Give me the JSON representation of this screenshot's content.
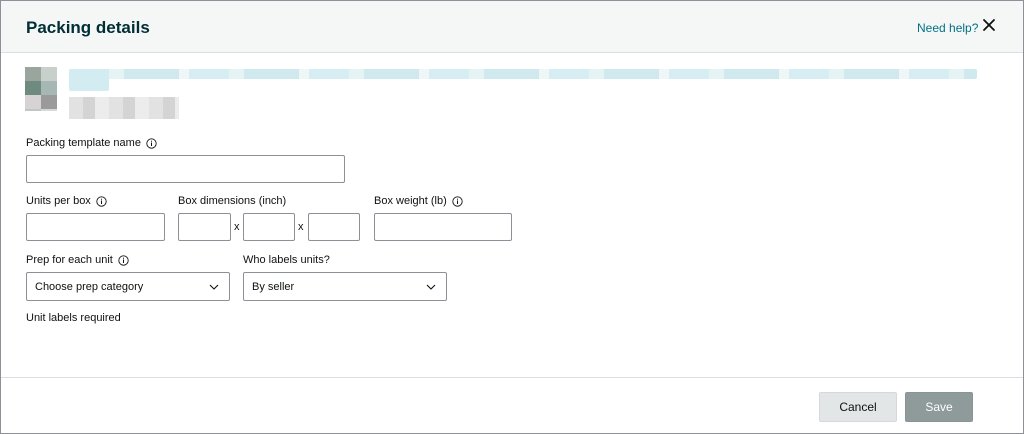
{
  "dialog": {
    "title": "Packing details",
    "help_link": "Need help?",
    "close_icon": "close-icon"
  },
  "fields": {
    "template_name": {
      "label": "Packing template name",
      "value": ""
    },
    "units_per_box": {
      "label": "Units per box",
      "value": ""
    },
    "box_dimensions": {
      "label": "Box dimensions (inch)",
      "separator": "x",
      "length": "",
      "width": "",
      "height": ""
    },
    "box_weight": {
      "label": "Box weight (lb)",
      "value": ""
    },
    "prep": {
      "label": "Prep for each unit",
      "selected": "Choose prep category"
    },
    "who_labels": {
      "label": "Who labels units?",
      "selected": "By seller"
    }
  },
  "note": "Unit labels required",
  "footer": {
    "cancel_label": "Cancel",
    "save_label": "Save"
  },
  "colors": {
    "title": "#002f36",
    "link": "#007185",
    "save_disabled": "#8f9b9b",
    "cancel": "#e3e6e6"
  }
}
